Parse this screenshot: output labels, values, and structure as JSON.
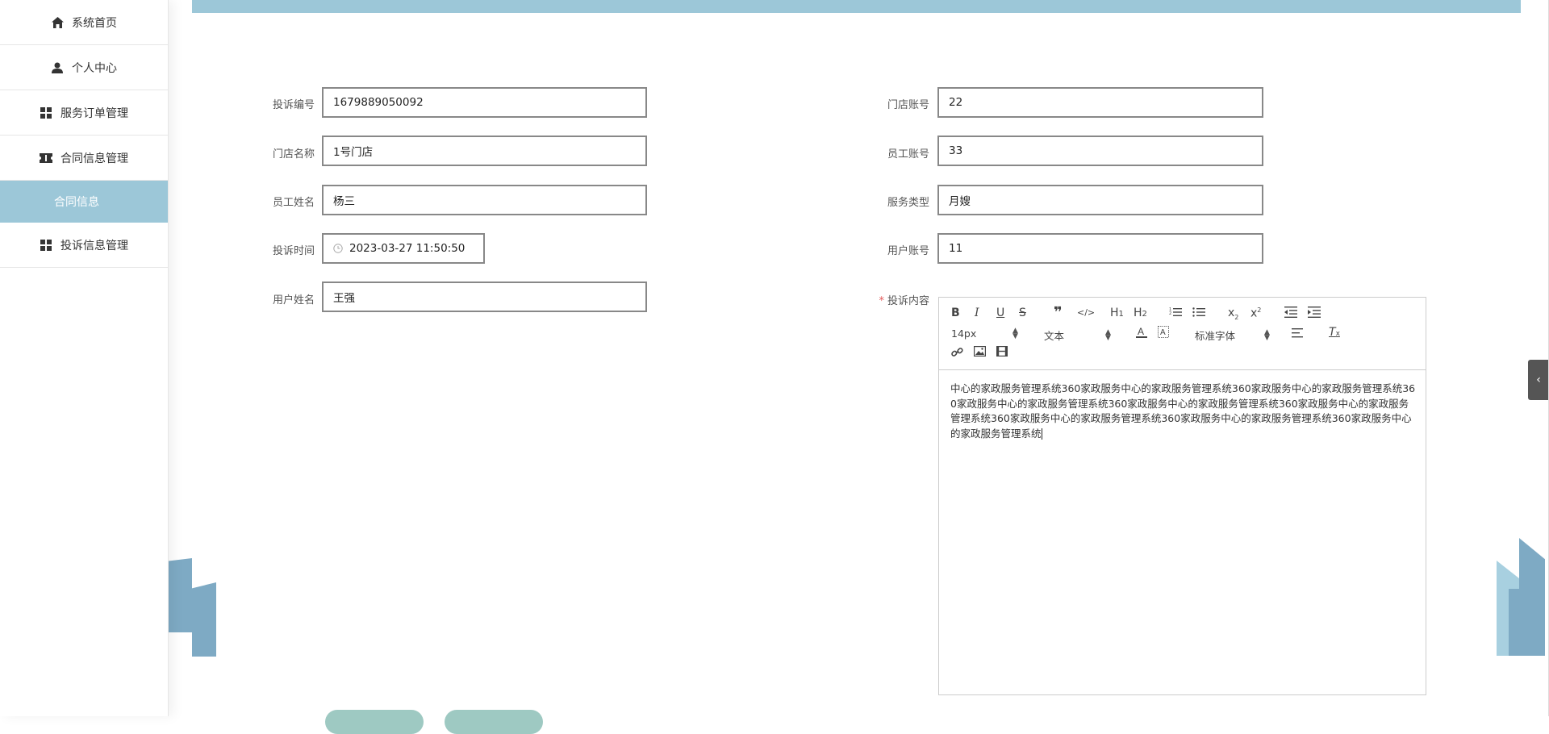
{
  "sidebar": {
    "items": [
      {
        "label": "系统首页",
        "icon": "home-icon"
      },
      {
        "label": "个人中心",
        "icon": "user-icon"
      },
      {
        "label": "服务订单管理",
        "icon": "grid-icon"
      },
      {
        "label": "合同信息管理",
        "icon": "ticket-icon"
      },
      {
        "label": "合同信息",
        "icon": ""
      },
      {
        "label": "投诉信息管理",
        "icon": "grid-icon"
      }
    ]
  },
  "form": {
    "complaint_no": {
      "label": "投诉编号",
      "value": "1679889050092"
    },
    "store_name": {
      "label": "门店名称",
      "value": "1号门店"
    },
    "staff_name": {
      "label": "员工姓名",
      "value": "杨三"
    },
    "complaint_time": {
      "label": "投诉时间",
      "value": "2023-03-27 11:50:50"
    },
    "user_name": {
      "label": "用户姓名",
      "value": "王强"
    },
    "store_account": {
      "label": "门店账号",
      "value": "22"
    },
    "staff_account": {
      "label": "员工账号",
      "value": "33"
    },
    "service_type": {
      "label": "服务类型",
      "value": "月嫂"
    },
    "user_account": {
      "label": "用户账号",
      "value": "11"
    },
    "complaint_content": {
      "label": "投诉内容",
      "required_mark": "*"
    }
  },
  "editor": {
    "font_size": "14px",
    "block_type": "文本",
    "font_family": "标准字体",
    "content": "中心的家政服务管理系统360家政服务中心的家政服务管理系统360家政服务中心的家政服务管理系统360家政服务中心的家政服务管理系统360家政服务中心的家政服务管理系统360家政服务中心的家政服务管理系统360家政服务中心的家政服务管理系统360家政服务中心的家政服务管理系统360家政服务中心的家政服务管理系统"
  },
  "colors": {
    "accent": "#9cc7d8",
    "deco": "#7eaac4",
    "button": "#9ec9c2"
  }
}
